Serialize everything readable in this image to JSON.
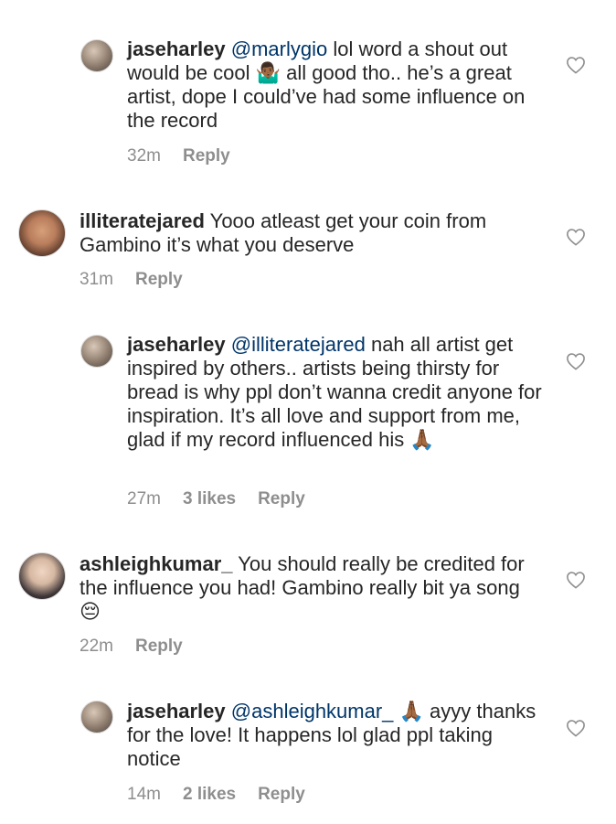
{
  "comments": [
    {
      "username": "jaseharley",
      "mention": "@marlygio",
      "text": "lol word a shout out would be cool 🤷🏾‍♂️ all good tho.. he’s a great artist, dope I could’ve had some influence on the record",
      "time": "32m",
      "likes": "",
      "reply": "Reply"
    },
    {
      "username": "illiteratejared",
      "mention": "",
      "text": "Yooo atleast get your coin from Gambino it’s what you deserve",
      "time": "31m",
      "likes": "",
      "reply": "Reply"
    },
    {
      "username": "jaseharley",
      "mention": "@illiteratejared",
      "text": "nah all artist get inspired by others.. artists being thirsty for bread is why ppl don’t wanna credit anyone for inspiration. It’s all love and support from me, glad if my record influenced his 🙏🏾",
      "time": "27m",
      "likes": "3 likes",
      "reply": "Reply"
    },
    {
      "username": "ashleighkumar_",
      "mention": "",
      "text": "You should really be credited for the influence you had! Gambino really bit ya song 😔",
      "time": "22m",
      "likes": "",
      "reply": "Reply"
    },
    {
      "username": "jaseharley",
      "mention": "@ashleighkumar_",
      "text": "🙏🏾 ayyy thanks for the love! It happens lol glad ppl taking notice",
      "time": "14m",
      "likes": "2 likes",
      "reply": "Reply"
    }
  ],
  "icons": {
    "like": "heart-outline-icon"
  },
  "colors": {
    "text": "#262626",
    "mention": "#003569",
    "meta": "#8e8e8e"
  }
}
